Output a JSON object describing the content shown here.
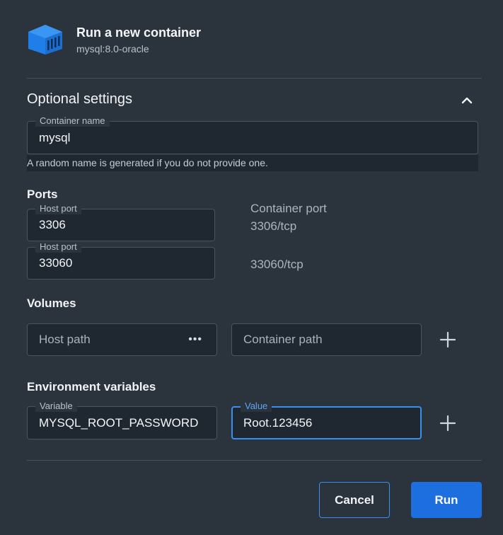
{
  "header": {
    "title": "Run a new container",
    "image": "mysql:8.0-oracle",
    "logo_icon": "container-box-icon"
  },
  "optional_settings": {
    "title": "Optional settings",
    "collapse_icon": "chevron-up-icon",
    "container_name": {
      "label": "Container name",
      "value": "mysql",
      "helper": "A random name is generated if you do not provide one."
    }
  },
  "ports": {
    "title": "Ports",
    "container_port_header": "Container port",
    "rows": [
      {
        "host_label": "Host port",
        "host_value": "3306",
        "container_port": "3306/tcp"
      },
      {
        "host_label": "Host port",
        "host_value": "33060",
        "container_port": "33060/tcp"
      }
    ]
  },
  "volumes": {
    "title": "Volumes",
    "host_path_placeholder": "Host path",
    "browse_label": "•••",
    "container_path_placeholder": "Container path"
  },
  "env": {
    "title": "Environment variables",
    "variable_label": "Variable",
    "variable_value": "MYSQL_ROOT_PASSWORD",
    "value_label": "Value",
    "value_value": "Root.123456"
  },
  "footer": {
    "cancel_label": "Cancel",
    "run_label": "Run"
  },
  "colors": {
    "background": "#2b333d",
    "accent": "#1d6fe0",
    "focus_border": "#3a8ff0"
  }
}
